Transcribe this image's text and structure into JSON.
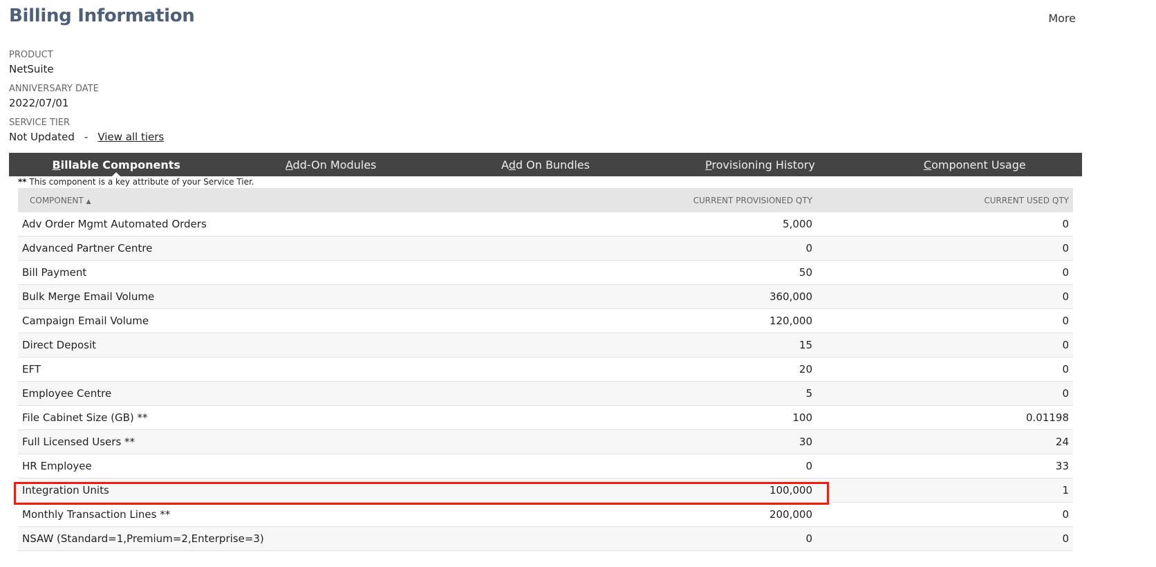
{
  "header": {
    "title": "Billing Information",
    "more_label": "More"
  },
  "fields": {
    "product": {
      "label": "PRODUCT",
      "value": "NetSuite"
    },
    "anniversary": {
      "label": "ANNIVERSARY DATE",
      "value": "2022/07/01"
    },
    "service_tier": {
      "label": "SERVICE TIER",
      "value": "Not Updated",
      "separator": "-",
      "link": "View all tiers"
    }
  },
  "tabs": [
    {
      "pre": "",
      "key": "B",
      "post": "illable Components",
      "active": true
    },
    {
      "pre": "",
      "key": "A",
      "post": "dd-On Modules",
      "active": false
    },
    {
      "pre": "A",
      "key": "d",
      "post": "d On Bundles",
      "active": false
    },
    {
      "pre": "",
      "key": "P",
      "post": "rovisioning History",
      "active": false
    },
    {
      "pre": "",
      "key": "C",
      "post": "omponent Usage",
      "active": false
    }
  ],
  "note": {
    "stars": "**",
    "text": " This component is a key attribute of your Service Tier."
  },
  "table": {
    "columns": [
      "COMPONENT",
      "CURRENT PROVISIONED QTY",
      "CURRENT USED QTY"
    ],
    "sort_indicator": "▲",
    "rows": [
      [
        "Adv Order Mgmt Automated Orders",
        "5,000",
        "0"
      ],
      [
        "Advanced Partner Centre",
        "0",
        "0"
      ],
      [
        "Bill Payment",
        "50",
        "0"
      ],
      [
        "Bulk Merge Email Volume",
        "360,000",
        "0"
      ],
      [
        "Campaign Email Volume",
        "120,000",
        "0"
      ],
      [
        "Direct Deposit",
        "15",
        "0"
      ],
      [
        "EFT",
        "20",
        "0"
      ],
      [
        "Employee Centre",
        "5",
        "0"
      ],
      [
        "File Cabinet Size (GB) **",
        "100",
        "0.01198"
      ],
      [
        "Full Licensed Users **",
        "30",
        "24"
      ],
      [
        "HR Employee",
        "0",
        "33"
      ],
      [
        "Integration Units",
        "100,000",
        "1"
      ],
      [
        "Monthly Transaction Lines **",
        "200,000",
        "0"
      ],
      [
        "NSAW (Standard=1,Premium=2,Enterprise=3)",
        "0",
        "0"
      ]
    ]
  },
  "highlight_color": "#f21c0c"
}
